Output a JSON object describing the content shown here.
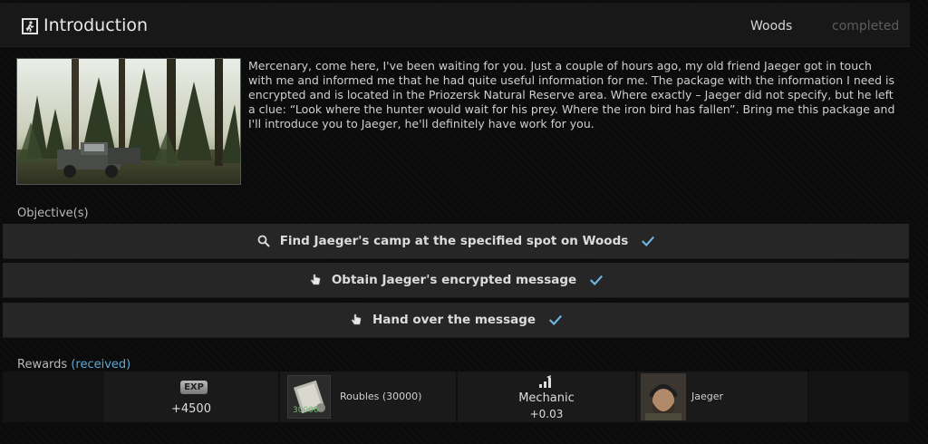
{
  "header": {
    "title": "Introduction",
    "location": "Woods",
    "status": "completed",
    "quest_icon": "exit-running-man-icon"
  },
  "description": "Mercenary, come here, I've been waiting for you. Just a couple of hours ago, my old friend Jaeger got in touch with me and informed me that he had quite useful information for me. The package with the information I need is encrypted and is located in the Priozersk Natural Reserve area. Where exactly – Jaeger did not specify, but he left a clue: “Look where the hunter would wait for his prey. Where the iron bird has fallen”. Bring me this package and I'll introduce you to Jaeger, he'll definitely have work for you.",
  "objectives": {
    "label": "Objective(s)",
    "items": [
      {
        "text": "Find Jaeger's camp at the specified spot on Woods",
        "icon": "search-icon",
        "completed": true
      },
      {
        "text": "Obtain Jaeger's encrypted message",
        "icon": "hand-pointer-icon",
        "completed": true
      },
      {
        "text": "Hand over the message",
        "icon": "hand-pointer-icon",
        "completed": true
      }
    ]
  },
  "rewards": {
    "label": "Rewards",
    "received_label": "(received)",
    "exp": {
      "badge": "EXP",
      "value": "+4500"
    },
    "roubles": {
      "label": "Roubles (30000)",
      "count": "30000"
    },
    "skill": {
      "name": "Mechanic",
      "value": "+0.03",
      "icon": "skill-chart-icon"
    },
    "trader": {
      "name": "Jaeger"
    }
  },
  "colors": {
    "accent_check": "#6fb8e6",
    "received": "#5fa9d6",
    "status_muted": "#5d5d5d"
  }
}
